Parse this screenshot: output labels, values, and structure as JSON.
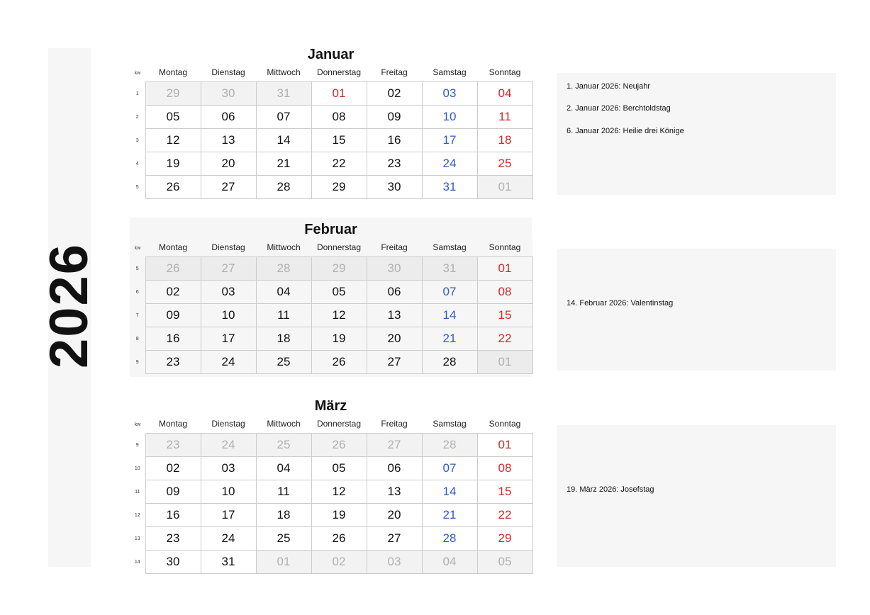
{
  "year": "2026",
  "kw_label": "kw",
  "days_of_week": [
    "Montag",
    "Dienstag",
    "Mittwoch",
    "Donnerstag",
    "Freitag",
    "Samstag",
    "Sonntag"
  ],
  "months": [
    {
      "key": "januar",
      "title": "Januar",
      "weeks": [
        {
          "kw": "1",
          "cells": [
            {
              "d": "29",
              "t": "other"
            },
            {
              "d": "30",
              "t": "other"
            },
            {
              "d": "31",
              "t": "other"
            },
            {
              "d": "01",
              "t": "sun"
            },
            {
              "d": "02",
              "t": "normal"
            },
            {
              "d": "03",
              "t": "sat"
            },
            {
              "d": "04",
              "t": "sun"
            }
          ]
        },
        {
          "kw": "2",
          "cells": [
            {
              "d": "05",
              "t": "normal"
            },
            {
              "d": "06",
              "t": "normal"
            },
            {
              "d": "07",
              "t": "normal"
            },
            {
              "d": "08",
              "t": "normal"
            },
            {
              "d": "09",
              "t": "normal"
            },
            {
              "d": "10",
              "t": "sat"
            },
            {
              "d": "11",
              "t": "sun"
            }
          ]
        },
        {
          "kw": "3",
          "cells": [
            {
              "d": "12",
              "t": "normal"
            },
            {
              "d": "13",
              "t": "normal"
            },
            {
              "d": "14",
              "t": "normal"
            },
            {
              "d": "15",
              "t": "normal"
            },
            {
              "d": "16",
              "t": "normal"
            },
            {
              "d": "17",
              "t": "sat"
            },
            {
              "d": "18",
              "t": "sun"
            }
          ]
        },
        {
          "kw": "4",
          "cells": [
            {
              "d": "19",
              "t": "normal"
            },
            {
              "d": "20",
              "t": "normal"
            },
            {
              "d": "21",
              "t": "normal"
            },
            {
              "d": "22",
              "t": "normal"
            },
            {
              "d": "23",
              "t": "normal"
            },
            {
              "d": "24",
              "t": "sat"
            },
            {
              "d": "25",
              "t": "sun"
            }
          ]
        },
        {
          "kw": "5",
          "cells": [
            {
              "d": "26",
              "t": "normal"
            },
            {
              "d": "27",
              "t": "normal"
            },
            {
              "d": "28",
              "t": "normal"
            },
            {
              "d": "29",
              "t": "normal"
            },
            {
              "d": "30",
              "t": "normal"
            },
            {
              "d": "31",
              "t": "sat"
            },
            {
              "d": "01",
              "t": "other"
            }
          ]
        }
      ],
      "holidays": [
        "1. Januar 2026: Neujahr",
        "2. Januar 2026: Berchtoldstag",
        "6. Januar 2026: Heilie drei Könige"
      ]
    },
    {
      "key": "februar",
      "title": "Februar",
      "weeks": [
        {
          "kw": "5",
          "cells": [
            {
              "d": "26",
              "t": "other"
            },
            {
              "d": "27",
              "t": "other"
            },
            {
              "d": "28",
              "t": "other"
            },
            {
              "d": "29",
              "t": "other"
            },
            {
              "d": "30",
              "t": "other"
            },
            {
              "d": "31",
              "t": "other"
            },
            {
              "d": "01",
              "t": "sun"
            }
          ]
        },
        {
          "kw": "6",
          "cells": [
            {
              "d": "02",
              "t": "normal"
            },
            {
              "d": "03",
              "t": "normal"
            },
            {
              "d": "04",
              "t": "normal"
            },
            {
              "d": "05",
              "t": "normal"
            },
            {
              "d": "06",
              "t": "normal"
            },
            {
              "d": "07",
              "t": "sat"
            },
            {
              "d": "08",
              "t": "sun"
            }
          ]
        },
        {
          "kw": "7",
          "cells": [
            {
              "d": "09",
              "t": "normal"
            },
            {
              "d": "10",
              "t": "normal"
            },
            {
              "d": "11",
              "t": "normal"
            },
            {
              "d": "12",
              "t": "normal"
            },
            {
              "d": "13",
              "t": "normal"
            },
            {
              "d": "14",
              "t": "sat"
            },
            {
              "d": "15",
              "t": "sun"
            }
          ]
        },
        {
          "kw": "8",
          "cells": [
            {
              "d": "16",
              "t": "normal"
            },
            {
              "d": "17",
              "t": "normal"
            },
            {
              "d": "18",
              "t": "normal"
            },
            {
              "d": "19",
              "t": "normal"
            },
            {
              "d": "20",
              "t": "normal"
            },
            {
              "d": "21",
              "t": "sat"
            },
            {
              "d": "22",
              "t": "sun"
            }
          ]
        },
        {
          "kw": "9",
          "cells": [
            {
              "d": "23",
              "t": "normal"
            },
            {
              "d": "24",
              "t": "normal"
            },
            {
              "d": "25",
              "t": "normal"
            },
            {
              "d": "26",
              "t": "normal"
            },
            {
              "d": "27",
              "t": "normal"
            },
            {
              "d": "28",
              "t": "normal"
            },
            {
              "d": "01",
              "t": "other"
            }
          ]
        }
      ],
      "holidays": [
        "14. Februar 2026: Valentinstag"
      ]
    },
    {
      "key": "maerz",
      "title": "März",
      "weeks": [
        {
          "kw": "9",
          "cells": [
            {
              "d": "23",
              "t": "other"
            },
            {
              "d": "24",
              "t": "other"
            },
            {
              "d": "25",
              "t": "other"
            },
            {
              "d": "26",
              "t": "other"
            },
            {
              "d": "27",
              "t": "other"
            },
            {
              "d": "28",
              "t": "other"
            },
            {
              "d": "01",
              "t": "sun"
            }
          ]
        },
        {
          "kw": "10",
          "cells": [
            {
              "d": "02",
              "t": "normal"
            },
            {
              "d": "03",
              "t": "normal"
            },
            {
              "d": "04",
              "t": "normal"
            },
            {
              "d": "05",
              "t": "normal"
            },
            {
              "d": "06",
              "t": "normal"
            },
            {
              "d": "07",
              "t": "sat"
            },
            {
              "d": "08",
              "t": "sun"
            }
          ]
        },
        {
          "kw": "11",
          "cells": [
            {
              "d": "09",
              "t": "normal"
            },
            {
              "d": "10",
              "t": "normal"
            },
            {
              "d": "11",
              "t": "normal"
            },
            {
              "d": "12",
              "t": "normal"
            },
            {
              "d": "13",
              "t": "normal"
            },
            {
              "d": "14",
              "t": "sat"
            },
            {
              "d": "15",
              "t": "sun"
            }
          ]
        },
        {
          "kw": "12",
          "cells": [
            {
              "d": "16",
              "t": "normal"
            },
            {
              "d": "17",
              "t": "normal"
            },
            {
              "d": "18",
              "t": "normal"
            },
            {
              "d": "19",
              "t": "normal"
            },
            {
              "d": "20",
              "t": "normal"
            },
            {
              "d": "21",
              "t": "sat"
            },
            {
              "d": "22",
              "t": "sun"
            }
          ]
        },
        {
          "kw": "13",
          "cells": [
            {
              "d": "23",
              "t": "normal"
            },
            {
              "d": "24",
              "t": "normal"
            },
            {
              "d": "25",
              "t": "normal"
            },
            {
              "d": "26",
              "t": "normal"
            },
            {
              "d": "27",
              "t": "normal"
            },
            {
              "d": "28",
              "t": "sat"
            },
            {
              "d": "29",
              "t": "sun"
            }
          ]
        },
        {
          "kw": "14",
          "cells": [
            {
              "d": "30",
              "t": "normal"
            },
            {
              "d": "31",
              "t": "normal"
            },
            {
              "d": "01",
              "t": "other"
            },
            {
              "d": "02",
              "t": "other"
            },
            {
              "d": "03",
              "t": "other"
            },
            {
              "d": "04",
              "t": "other"
            },
            {
              "d": "05",
              "t": "other"
            }
          ]
        }
      ],
      "holidays": [
        "19. März 2026: Josefstag"
      ]
    }
  ]
}
